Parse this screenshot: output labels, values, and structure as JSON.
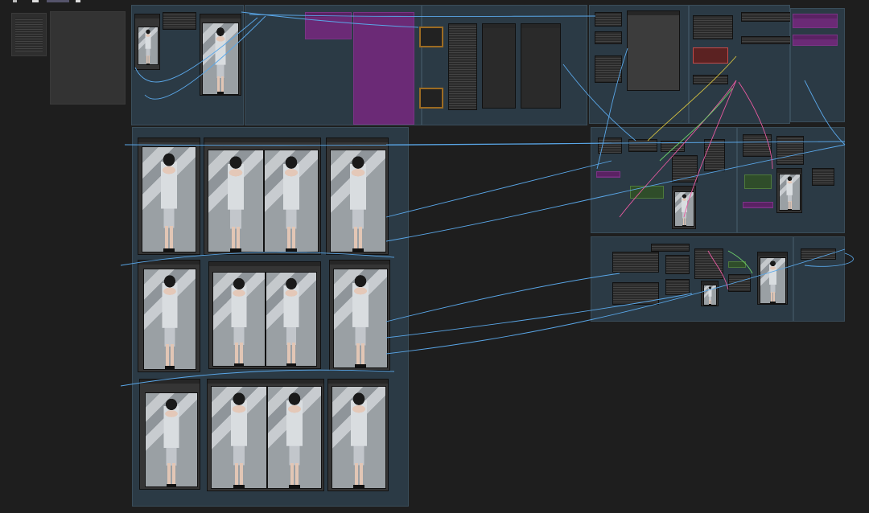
{
  "toolbar": {
    "icons": [
      "graph-icon",
      "save-icon",
      "active-tab",
      "close-icon"
    ]
  },
  "groups": [
    {
      "id": "top-a",
      "title": ""
    },
    {
      "id": "top-b",
      "title": ""
    },
    {
      "id": "top-c",
      "title": ""
    },
    {
      "id": "top-d",
      "title": ""
    },
    {
      "id": "top-e",
      "title": ""
    },
    {
      "id": "top-f",
      "title": ""
    },
    {
      "id": "gallery",
      "title": ""
    },
    {
      "id": "right-mid-a",
      "title": ""
    },
    {
      "id": "right-mid-b",
      "title": ""
    },
    {
      "id": "right-bottom-a",
      "title": ""
    },
    {
      "id": "right-bottom-b",
      "title": ""
    }
  ],
  "colors": {
    "canvas": "#1e1e1e",
    "group": "#2b3a45",
    "node": "#353535",
    "wire_blue": "#5aa7e8",
    "wire_pink": "#e85aa0",
    "wire_yellow": "#d8c440",
    "wire_green": "#6fd36b",
    "accent_purple": "#6b2a76",
    "accent_red": "#c24a4a",
    "accent_orange": "#9c6b22"
  },
  "gallery": {
    "preview_counts": [
      1,
      2,
      1,
      1,
      2,
      1,
      1,
      2,
      1
    ]
  }
}
